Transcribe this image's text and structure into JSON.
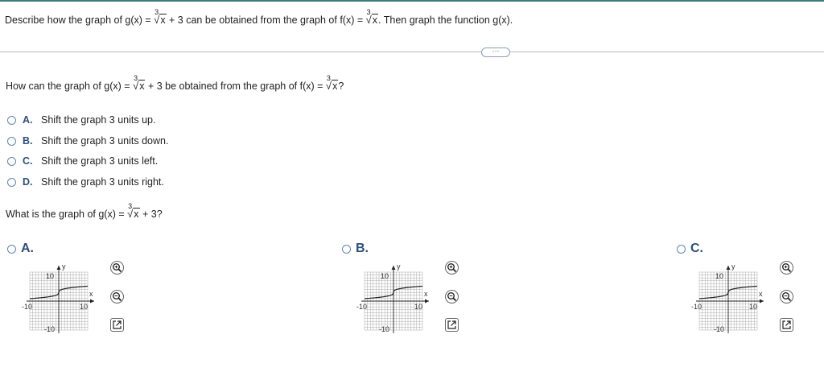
{
  "header": {
    "prompt": {
      "part1": "Describe how the graph of g(x) = ",
      "radical_index": "3",
      "radicand": "x",
      "part2": " + 3 can be obtained from the graph of f(x) = ",
      "part3": ". Then graph the function g(x)."
    },
    "more_button": "⋯"
  },
  "question1": {
    "part1": "How can the graph of g(x) = ",
    "part2": " + 3 be obtained from the graph of f(x) = ",
    "part3": "?"
  },
  "choices": [
    {
      "letter": "A.",
      "text": "Shift the graph 3 units up."
    },
    {
      "letter": "B.",
      "text": "Shift the graph 3 units down."
    },
    {
      "letter": "C.",
      "text": "Shift the graph 3 units left."
    },
    {
      "letter": "D.",
      "text": "Shift the graph 3 units right."
    }
  ],
  "question2": {
    "part1": "What is the graph of g(x) = ",
    "part2": " + 3?"
  },
  "graph_options": [
    {
      "letter": "A.",
      "shift": "up",
      "offset": 3
    },
    {
      "letter": "B.",
      "shift": "up",
      "offset": 3
    },
    {
      "letter": "C.",
      "shift": "up",
      "offset": 3
    }
  ],
  "graph_labels": {
    "y": "y",
    "x": "x",
    "y_max": "10",
    "y_min": "-10",
    "x_min": "-10",
    "x_max": "10"
  },
  "colors": {
    "link": "#2d4f7c",
    "radio": "#5f86b3",
    "grid": "#aaaaaa",
    "curve": "#222222"
  },
  "icons": [
    "zoom-in-icon",
    "zoom-out-icon",
    "popout-icon"
  ]
}
